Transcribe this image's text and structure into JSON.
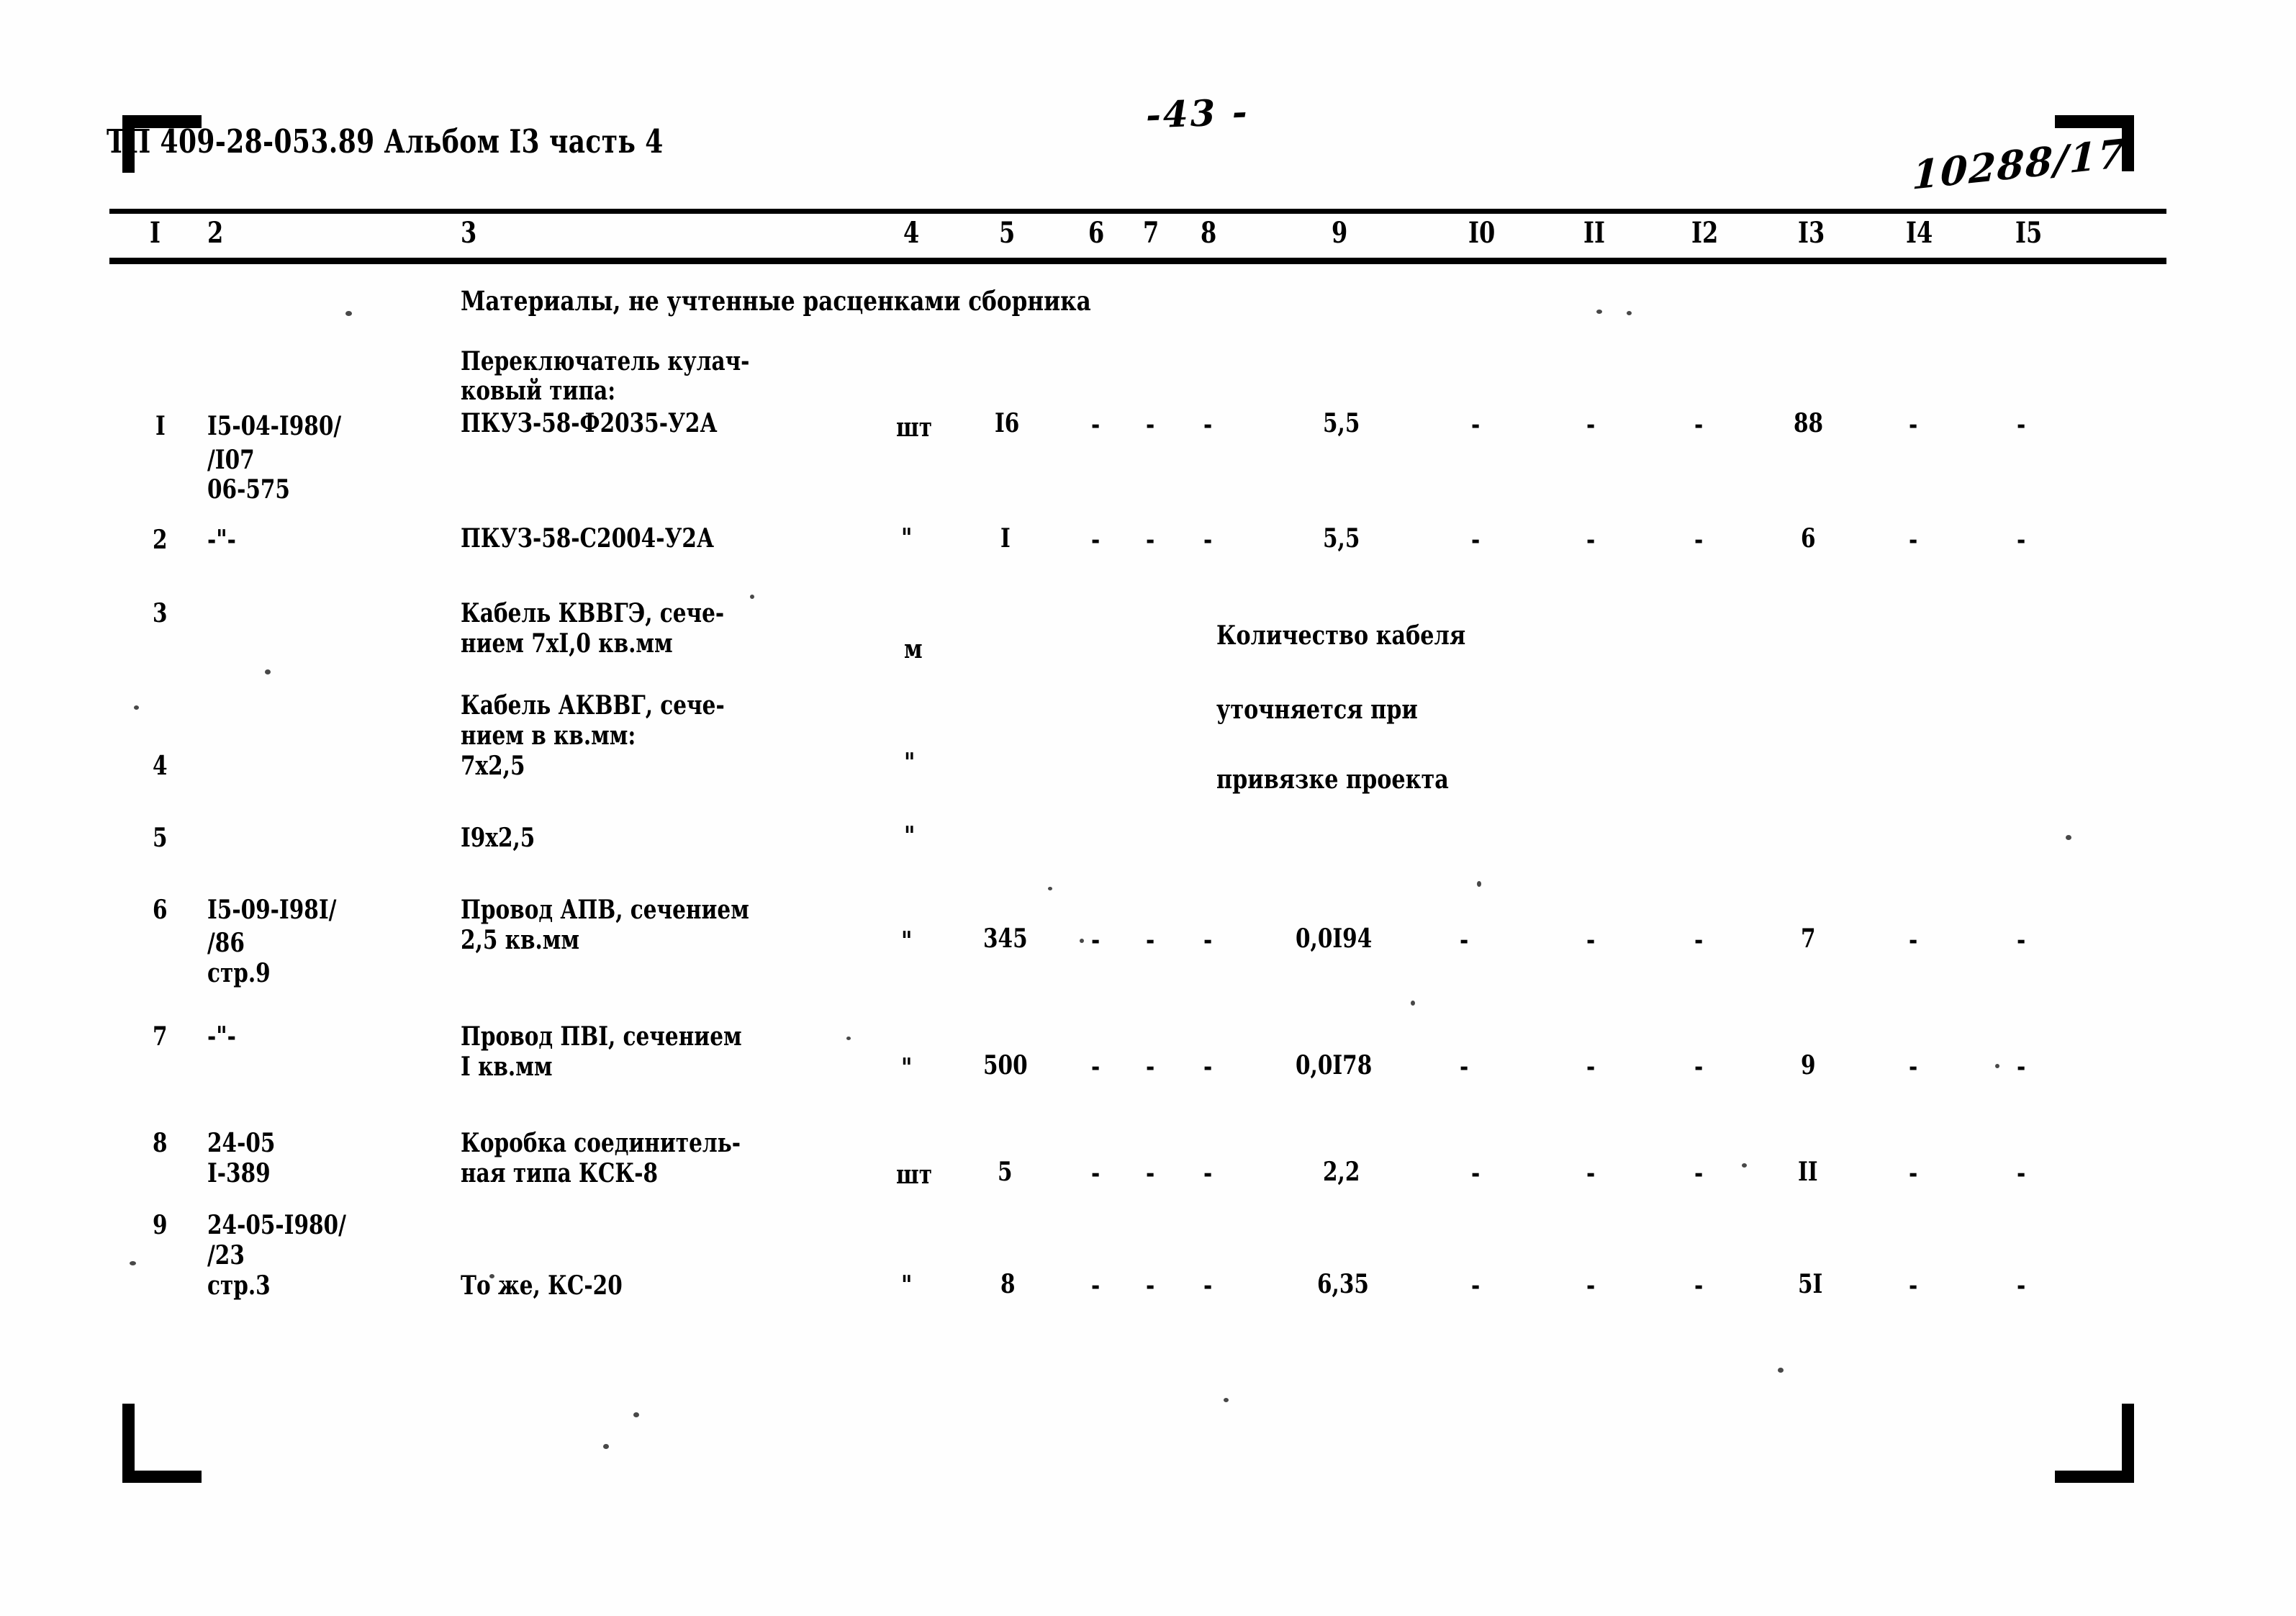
{
  "document": {
    "header_title": "ТП 409-28-053.89 Альбом I3 часть 4",
    "page_number": "-43 -",
    "archive_code": "10288/17"
  },
  "table": {
    "column_numbers": [
      "I",
      "2",
      "3",
      "4",
      "5",
      "6",
      "7",
      "8",
      "9",
      "I0",
      "II",
      "I2",
      "I3",
      "I4",
      "I5"
    ],
    "section_heading": "Материалы, не учтенные расценками сборника",
    "note": {
      "line1": "Количество кабеля",
      "line2": "уточняется при",
      "line3": "привязке проекта"
    },
    "rows": [
      {
        "no": "I",
        "code_lines": [
          "I5-04-I980/",
          "/I07",
          "06-575"
        ],
        "desc_lines": [
          "Переключатель кулач-",
          "ковый типа:",
          "ПКУЗ-58-Ф2035-У2А"
        ],
        "unit": "шт",
        "qty": "I6",
        "c6": "-",
        "c7": "-",
        "c8": "-",
        "c9": "5,5",
        "c10": "-",
        "c11": "-",
        "c12": "-",
        "c13": "88",
        "c14": "-",
        "c15": "-"
      },
      {
        "no": "2",
        "code_lines": [
          "-\"-"
        ],
        "desc_lines": [
          "ПКУЗ-58-С2004-У2А"
        ],
        "unit": "\"",
        "qty": "I",
        "c6": "-",
        "c7": "-",
        "c8": "-",
        "c9": "5,5",
        "c10": "-",
        "c11": "-",
        "c12": "-",
        "c13": "6",
        "c14": "-",
        "c15": "-"
      },
      {
        "no": "3",
        "code_lines": [],
        "desc_lines": [
          "Кабель КВВГЭ, сече-",
          "нием 7хI,0 кв.мм"
        ],
        "unit": "м",
        "qty": "",
        "c6": "",
        "c7": "",
        "c8": "",
        "c9": "",
        "c10": "",
        "c11": "",
        "c12": "",
        "c13": "",
        "c14": "",
        "c15": ""
      },
      {
        "no": "4",
        "code_lines": [],
        "desc_lines": [
          "Кабель АКВВГ, сече-",
          "нием в кв.мм:",
          "7х2,5"
        ],
        "unit": "\"",
        "qty": "",
        "c6": "",
        "c7": "",
        "c8": "",
        "c9": "",
        "c10": "",
        "c11": "",
        "c12": "",
        "c13": "",
        "c14": "",
        "c15": ""
      },
      {
        "no": "5",
        "code_lines": [],
        "desc_lines": [
          "I9х2,5"
        ],
        "unit": "\"",
        "qty": "",
        "c6": "",
        "c7": "",
        "c8": "",
        "c9": "",
        "c10": "",
        "c11": "",
        "c12": "",
        "c13": "",
        "c14": "",
        "c15": ""
      },
      {
        "no": "6",
        "code_lines": [
          "I5-09-I98I/",
          "/86",
          "стр.9"
        ],
        "desc_lines": [
          "Провод АПВ, сечением",
          "2,5 кв.мм"
        ],
        "unit": "\"",
        "qty": "345",
        "c6": "-",
        "c7": "-",
        "c8": "-",
        "c9": "0,0I94",
        "c10": "-",
        "c11": "-",
        "c12": "-",
        "c13": "7",
        "c14": "-",
        "c15": "-"
      },
      {
        "no": "7",
        "code_lines": [
          "-\"-"
        ],
        "desc_lines": [
          "Провод ПВI, сечением",
          "I кв.мм"
        ],
        "unit": "\"",
        "qty": "500",
        "c6": "-",
        "c7": "-",
        "c8": "-",
        "c9": "0,0I78",
        "c10": "-",
        "c11": "-",
        "c12": "-",
        "c13": "9",
        "c14": "-",
        "c15": "-"
      },
      {
        "no": "8",
        "code_lines": [
          "24-05",
          "I-389"
        ],
        "desc_lines": [
          "Коробка соединитель-",
          "ная типа КСК-8"
        ],
        "unit": "шт",
        "qty": "5",
        "c6": "-",
        "c7": "-",
        "c8": "-",
        "c9": "2,2",
        "c10": "-",
        "c11": "-",
        "c12": "-",
        "c13": "II",
        "c14": "-",
        "c15": "-"
      },
      {
        "no": "9",
        "code_lines": [
          "24-05-I980/",
          "/23",
          "стр.3"
        ],
        "desc_lines": [
          "То же, КС-20"
        ],
        "unit": "\"",
        "qty": "8",
        "c6": "-",
        "c7": "-",
        "c8": "-",
        "c9": "6,35",
        "c10": "-",
        "c11": "-",
        "c12": "-",
        "c13": "5I",
        "c14": "-",
        "c15": "-"
      }
    ]
  }
}
